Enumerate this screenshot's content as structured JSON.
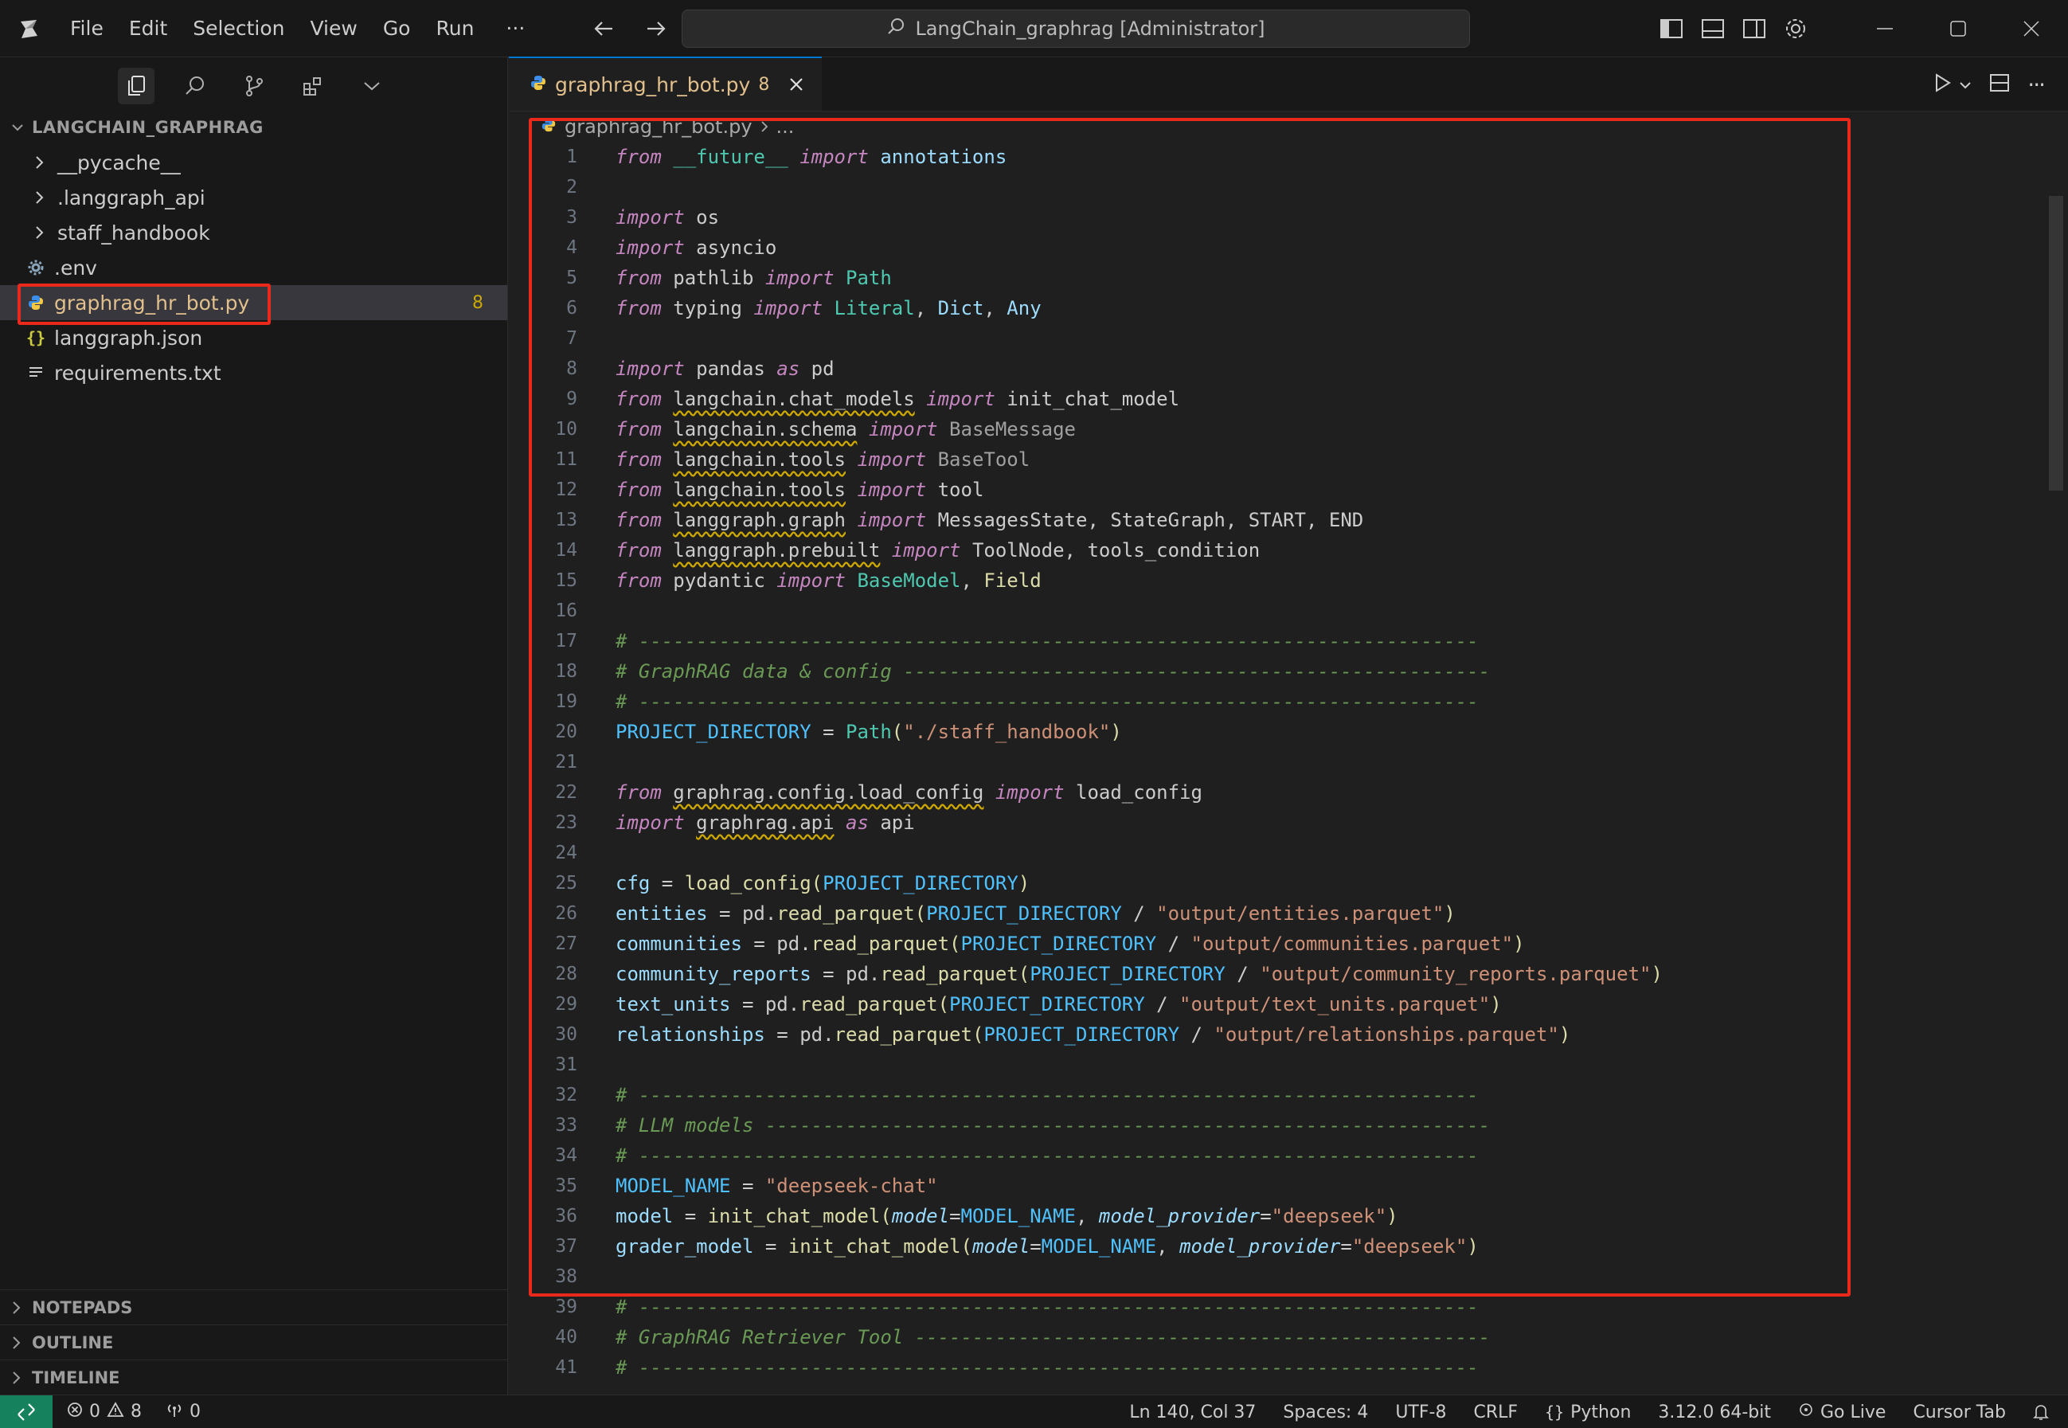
{
  "titlebar": {
    "menu": [
      "File",
      "Edit",
      "Selection",
      "View",
      "Go",
      "Run",
      "···"
    ],
    "search_text": "LangChain_graphrag [Administrator]"
  },
  "explorer": {
    "workspace": "LANGCHAIN_GRAPHRAG",
    "folders": [
      "__pycache__",
      ".langgraph_api",
      "staff_handbook"
    ],
    "files": [
      {
        "name": ".env",
        "icon": "gear-icon"
      },
      {
        "name": "graphrag_hr_bot.py",
        "icon": "python-icon",
        "badge": "8",
        "selected": true
      },
      {
        "name": "langgraph.json",
        "icon": "json-icon"
      },
      {
        "name": "requirements.txt",
        "icon": "text-file-icon"
      }
    ],
    "bottom_sections": [
      "NOTEPADS",
      "OUTLINE",
      "TIMELINE"
    ]
  },
  "editor": {
    "tab": {
      "title": "graphrag_hr_bot.py",
      "problems": "8"
    },
    "breadcrumb": {
      "file": "graphrag_hr_bot.py",
      "rest": "..."
    },
    "lines": [
      {
        "n": "1"
      },
      {
        "n": "2"
      },
      {
        "n": "3"
      },
      {
        "n": "4"
      },
      {
        "n": "5"
      },
      {
        "n": "6"
      },
      {
        "n": "7"
      },
      {
        "n": "8"
      },
      {
        "n": "9"
      },
      {
        "n": "10"
      },
      {
        "n": "11"
      },
      {
        "n": "12"
      },
      {
        "n": "13"
      },
      {
        "n": "14"
      },
      {
        "n": "15"
      },
      {
        "n": "16"
      },
      {
        "n": "17"
      },
      {
        "n": "18"
      },
      {
        "n": "19"
      },
      {
        "n": "20"
      },
      {
        "n": "21"
      },
      {
        "n": "22"
      },
      {
        "n": "23"
      },
      {
        "n": "24"
      },
      {
        "n": "25"
      },
      {
        "n": "26"
      },
      {
        "n": "27"
      },
      {
        "n": "28"
      },
      {
        "n": "29"
      },
      {
        "n": "30"
      },
      {
        "n": "31"
      },
      {
        "n": "32"
      },
      {
        "n": "33"
      },
      {
        "n": "34"
      },
      {
        "n": "35"
      },
      {
        "n": "36"
      },
      {
        "n": "37"
      },
      {
        "n": "38"
      },
      {
        "n": "39"
      },
      {
        "n": "40"
      },
      {
        "n": "41"
      }
    ],
    "code": {
      "l1": [
        "from",
        " __future__ ",
        "import",
        " annotations"
      ],
      "l3": [
        "import",
        " os"
      ],
      "l4": [
        "import",
        " asyncio"
      ],
      "l5": [
        "from",
        " pathlib ",
        "import",
        " Path"
      ],
      "l6": [
        "from",
        " typing ",
        "import",
        " Literal",
        ", ",
        "Dict",
        ", ",
        "Any"
      ],
      "l8": [
        "import",
        " pandas ",
        "as",
        " pd"
      ],
      "l9": [
        "from",
        " ",
        "langchain.chat_models",
        " ",
        "import",
        " init_chat_model"
      ],
      "l10": [
        "from",
        " ",
        "langchain.schema",
        " ",
        "import",
        " BaseMessage"
      ],
      "l11": [
        "from",
        " ",
        "langchain.tools",
        " ",
        "import",
        " BaseTool"
      ],
      "l12": [
        "from",
        " ",
        "langchain.tools",
        " ",
        "import",
        " tool"
      ],
      "l13": [
        "from",
        " ",
        "langgraph.graph",
        " ",
        "import",
        " MessagesState, StateGraph, START, END"
      ],
      "l14": [
        "from",
        " ",
        "langgraph.prebuilt",
        " ",
        "import",
        " ToolNode, tools_condition"
      ],
      "l15": [
        "from",
        " pydantic ",
        "import",
        " BaseModel",
        ", ",
        "Field"
      ],
      "l17": "# -------------------------------------------------------------------------",
      "l18": "# GraphRAG data & config ---------------------------------------------------",
      "l19": "# -------------------------------------------------------------------------",
      "l20": [
        "PROJECT_DIRECTORY",
        " = ",
        "Path",
        "(",
        "\"./staff_handbook\"",
        ")"
      ],
      "l22": [
        "from",
        " ",
        "graphrag.config.load_config",
        " ",
        "import",
        " load_config"
      ],
      "l23": [
        "import",
        " ",
        "graphrag.api",
        " ",
        "as",
        " api"
      ],
      "l25": [
        "cfg",
        " = ",
        "load_config",
        "(",
        "PROJECT_DIRECTORY",
        ")"
      ],
      "l26": [
        "entities",
        " = pd.",
        "read_parquet",
        "(",
        "PROJECT_DIRECTORY",
        " / ",
        "\"output/entities.parquet\"",
        ")"
      ],
      "l27": [
        "communities",
        " = pd.",
        "read_parquet",
        "(",
        "PROJECT_DIRECTORY",
        " / ",
        "\"output/communities.parquet\"",
        ")"
      ],
      "l28": [
        "community_reports",
        " = pd.",
        "read_parquet",
        "(",
        "PROJECT_DIRECTORY",
        " / ",
        "\"output/community_reports.parquet\"",
        ")"
      ],
      "l29": [
        "text_units",
        " = pd.",
        "read_parquet",
        "(",
        "PROJECT_DIRECTORY",
        " / ",
        "\"output/text_units.parquet\"",
        ")"
      ],
      "l30": [
        "relationships",
        " = pd.",
        "read_parquet",
        "(",
        "PROJECT_DIRECTORY",
        " / ",
        "\"output/relationships.parquet\"",
        ")"
      ],
      "l32": "# -------------------------------------------------------------------------",
      "l33": "# LLM models ---------------------------------------------------------------",
      "l34": "# -------------------------------------------------------------------------",
      "l35": [
        "MODEL_NAME",
        " = ",
        "\"deepseek-chat\""
      ],
      "l36": [
        "model",
        " = ",
        "init_chat_model",
        "(",
        "model",
        "=",
        "MODEL_NAME",
        ", ",
        "model_provider",
        "=",
        "\"deepseek\"",
        ")"
      ],
      "l37": [
        "grader_model",
        " = ",
        "init_chat_model",
        "(",
        "model",
        "=",
        "MODEL_NAME",
        ", ",
        "model_provider",
        "=",
        "\"deepseek\"",
        ")"
      ],
      "l39": "# -------------------------------------------------------------------------",
      "l40": "# GraphRAG Retriever Tool --------------------------------------------------",
      "l41": "# -------------------------------------------------------------------------"
    }
  },
  "statusbar": {
    "errors": "0",
    "warnings": "8",
    "ports": "0",
    "position": "Ln 140, Col 37",
    "spaces": "Spaces: 4",
    "encoding": "UTF-8",
    "eol": "CRLF",
    "language": "Python",
    "interpreter": "3.12.0 64-bit",
    "go_live": "Go Live",
    "cursor_tab": "Cursor Tab"
  },
  "colors": {
    "accent": "#0078d4",
    "highlight_box": "#e8291c",
    "modified": "#e2c08d",
    "remote": "#16825d"
  }
}
